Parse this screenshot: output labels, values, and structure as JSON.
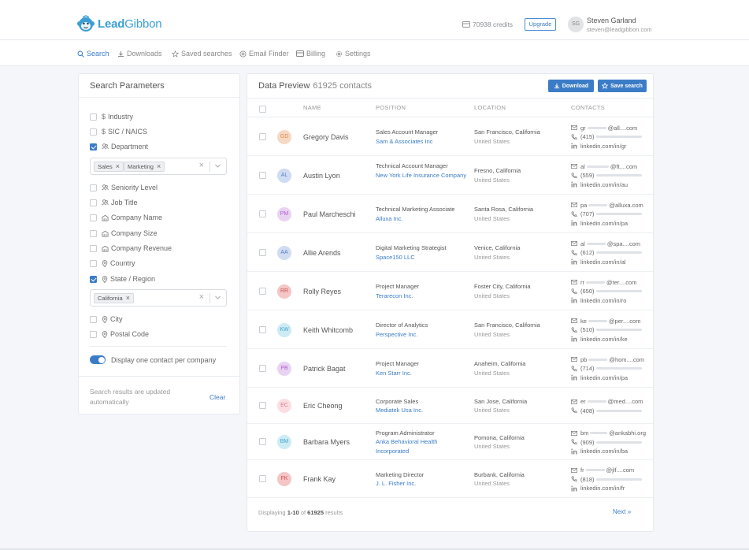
{
  "brand": {
    "name_bold": "Lead",
    "name_thin": "Gibbon"
  },
  "header": {
    "credits": "70938 credits",
    "upgrade_label": "Upgrade",
    "user_initials": "SG",
    "user_name": "Steven Garland",
    "user_email": "steven@leadgibbon.com"
  },
  "nav": {
    "items": [
      {
        "label": "Search",
        "icon": "search-icon"
      },
      {
        "label": "Downloads",
        "icon": "download-icon"
      },
      {
        "label": "Saved searches",
        "icon": "star-icon"
      },
      {
        "label": "Email Finder",
        "icon": "at-icon"
      },
      {
        "label": "Billing",
        "icon": "card-icon"
      },
      {
        "label": "Settings",
        "icon": "gear-icon"
      }
    ]
  },
  "params": {
    "title": "Search Parameters",
    "filters": [
      {
        "label": "Industry",
        "icon": "dollar-icon",
        "checked": false
      },
      {
        "label": "SIC / NAICS",
        "icon": "dollar-icon",
        "checked": false
      },
      {
        "label": "Department",
        "icon": "users-icon",
        "checked": true
      },
      {
        "label": "Seniority Level",
        "icon": "users-icon",
        "checked": false
      },
      {
        "label": "Job Title",
        "icon": "users-icon",
        "checked": false
      },
      {
        "label": "Company Name",
        "icon": "building-icon",
        "checked": false
      },
      {
        "label": "Company Size",
        "icon": "building-icon",
        "checked": false
      },
      {
        "label": "Company Revenue",
        "icon": "building-icon",
        "checked": false
      },
      {
        "label": "Country",
        "icon": "pin-icon",
        "checked": false
      },
      {
        "label": "State / Region",
        "icon": "pin-icon",
        "checked": true
      },
      {
        "label": "City",
        "icon": "pin-icon",
        "checked": false
      },
      {
        "label": "Postal Code",
        "icon": "pin-icon",
        "checked": false
      }
    ],
    "department_tags": [
      "Sales",
      "Marketing"
    ],
    "state_tags": [
      "California"
    ],
    "toggle_label": "Display one contact per company",
    "toggle_on": true,
    "footnote": "Search results are updated automatically",
    "clear_label": "Clear"
  },
  "data": {
    "title": "Data Preview",
    "count": "61925 contacts",
    "download_label": "Download",
    "save_label": "Save search",
    "columns": [
      "NAME",
      "POSITION",
      "LOCATION",
      "CONTACTS"
    ],
    "rows": [
      {
        "initials": "GD",
        "name": "Gregory Davis",
        "title": "Sales Account Manager",
        "company": "Sam & Associates Inc",
        "city": "San Francisco, California",
        "country": "United States",
        "email_a": "gr",
        "email_b": "@all....com",
        "phone": "(415)",
        "linkedin": "linkedin.com/in/gr",
        "color": "#f6d9c4",
        "text": "#e38a4f"
      },
      {
        "initials": "AL",
        "name": "Austin Lyon",
        "title": "Technical Account Manager",
        "company": "New York Life Insurance Company",
        "city": "Fresno, California",
        "country": "United States",
        "email_a": "al",
        "email_b": "@ft....com",
        "phone": "(559)",
        "linkedin": "linkedin.com/in/au",
        "color": "#cfdcf2",
        "text": "#5b7fc1"
      },
      {
        "initials": "PM",
        "name": "Paul Marcheschi",
        "title": "Technical Marketing Associate",
        "company": "Alluxa Inc.",
        "city": "Santa Rosa, California",
        "country": "United States",
        "email_a": "pa",
        "email_b": "@alluxa.com",
        "phone": "(707)",
        "linkedin": "linkedin.com/in/pa",
        "color": "#e9d3f3",
        "text": "#b25fd1"
      },
      {
        "initials": "AA",
        "name": "Allie Arends",
        "title": "Digital Marketing Strategist",
        "company": "Space150 LLC",
        "city": "Venice, California",
        "country": "United States",
        "email_a": "al",
        "email_b": "@spa....com",
        "phone": "(612)",
        "linkedin": "linkedin.com/in/al",
        "color": "#cfdcf2",
        "text": "#5b7fc1"
      },
      {
        "initials": "RR",
        "name": "Rolly Reyes",
        "title": "Project Manager",
        "company": "Terarecon Inc.",
        "city": "Foster City, California",
        "country": "United States",
        "email_a": "rr",
        "email_b": "@ter....com",
        "phone": "(650)",
        "linkedin": "linkedin.com/in/ro",
        "color": "#f4c6c6",
        "text": "#d05252"
      },
      {
        "initials": "KW",
        "name": "Keith Whitcomb",
        "title": "Director of Analytics",
        "company": "Perspective Inc.",
        "city": "San Francisco, California",
        "country": "United States",
        "email_a": "ke",
        "email_b": "@per....com",
        "phone": "(510)",
        "linkedin": "linkedin.com/in/ke",
        "color": "#cdebf5",
        "text": "#3fa6cf"
      },
      {
        "initials": "PB",
        "name": "Patrick Bagat",
        "title": "Project Manager",
        "company": "Ken Starr Inc.",
        "city": "Anaheim, California",
        "country": "United States",
        "email_a": "pb",
        "email_b": "@hom....com",
        "phone": "(714)",
        "linkedin": "linkedin.com/in/pa",
        "color": "#e9d3f3",
        "text": "#b25fd1"
      },
      {
        "initials": "EC",
        "name": "Eric Cheong",
        "title": "Corporate Sales",
        "company": "Mediatek Usa Inc.",
        "city": "San Jose, California",
        "country": "United States",
        "email_a": "er",
        "email_b": "@med....com",
        "phone": "(408)",
        "linkedin": "",
        "color": "#fbdde2",
        "text": "#e07b8d"
      },
      {
        "initials": "BM",
        "name": "Barbara Myers",
        "title": "Program Administrator",
        "company": "Anka Behavioral Health Incorporated",
        "city": "Pomona, California",
        "country": "United States",
        "email_a": "bm",
        "email_b": "@ankabhi.org",
        "phone": "(909)",
        "linkedin": "linkedin.com/in/ba",
        "color": "#cdebf5",
        "text": "#3fa6cf"
      },
      {
        "initials": "FK",
        "name": "Frank Kay",
        "title": "Marketing Director",
        "company": "J. L. Fisher Inc.",
        "city": "Burbank, California",
        "country": "United States",
        "email_a": "fr",
        "email_b": "@jlf....com",
        "phone": "(818)",
        "linkedin": "linkedin.com/in/fr",
        "color": "#f4c6c6",
        "text": "#d05252"
      }
    ],
    "pager_prefix": "Displaying",
    "pager_range": "1-10",
    "pager_of": "of",
    "pager_total": "61925",
    "pager_suffix": "results",
    "next_label": "Next"
  }
}
